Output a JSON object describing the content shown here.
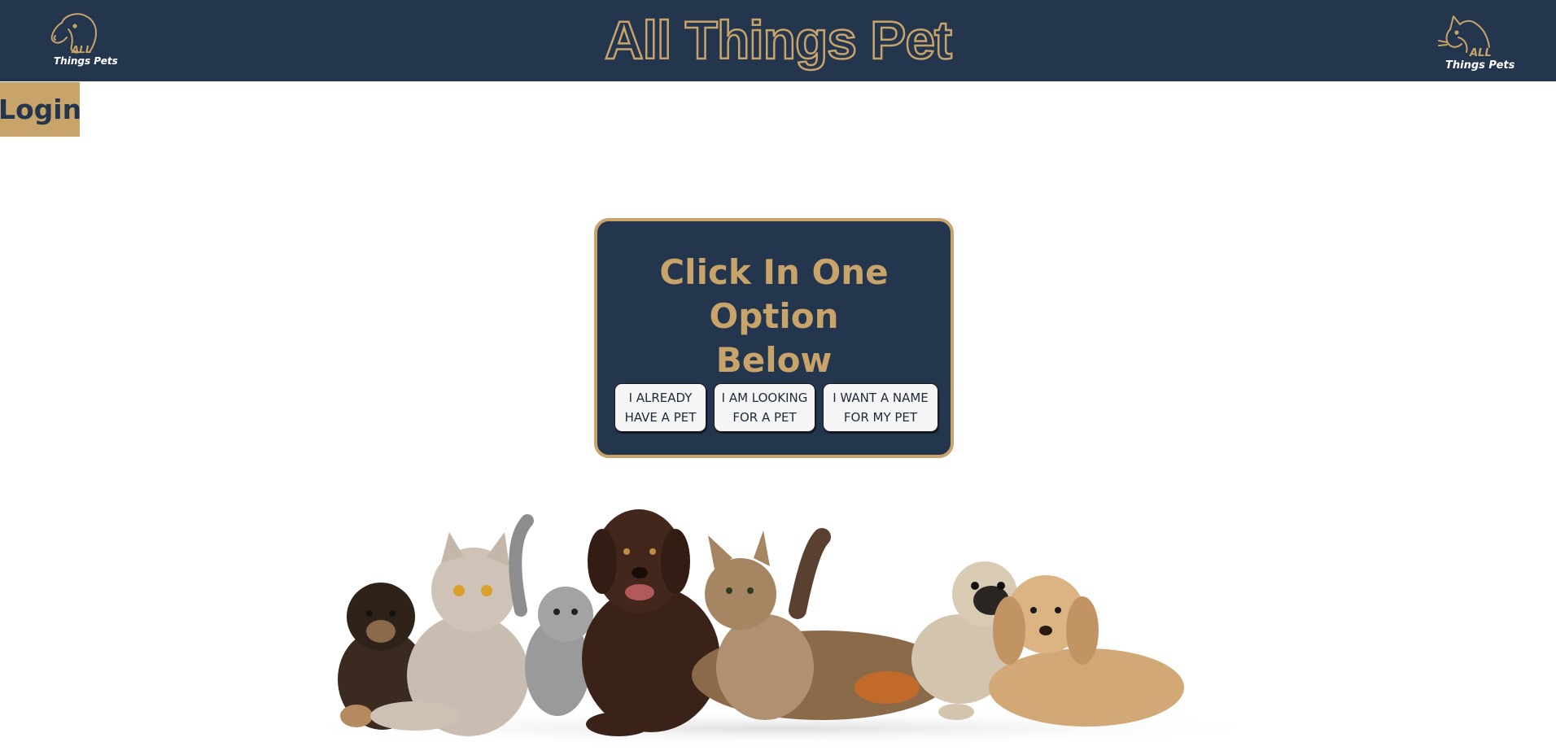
{
  "header": {
    "title": "All Things Pet",
    "logo_left": {
      "line1": "ALL",
      "line2": "Things Pets",
      "icon": "dog-head-icon"
    },
    "logo_right": {
      "line1": "ALL",
      "line2": "Things Pets",
      "icon": "cat-head-icon"
    }
  },
  "login": {
    "label": "Login"
  },
  "panel": {
    "title_line1": "Click In One Option",
    "title_line2": "Below",
    "options": [
      {
        "line1": "I ALREADY",
        "line2": "HAVE A PET"
      },
      {
        "line1": "I AM LOOKING",
        "line2": "FOR A PET"
      },
      {
        "line1": "I WANT A NAME",
        "line2": "FOR MY PET"
      }
    ]
  },
  "colors": {
    "navy": "#24364d",
    "gold": "#c9a46a",
    "white": "#ffffff"
  }
}
